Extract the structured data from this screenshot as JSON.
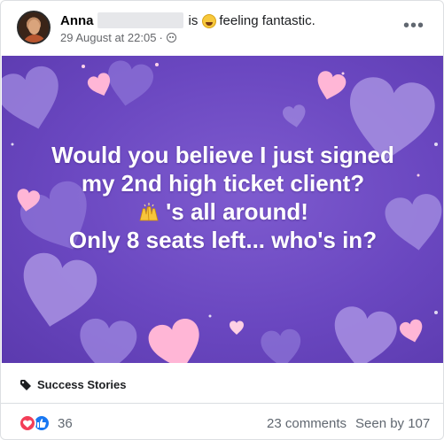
{
  "header": {
    "author": "Anna",
    "status_prefix": "is",
    "feeling_emoji": "laughing-face-icon",
    "feeling_text": "feeling fantastic.",
    "timestamp": "29 August at 22:05",
    "separator": "·",
    "audience_icon": "friends-icon",
    "more_label": "•••"
  },
  "post_image": {
    "text_lines": [
      "Would you believe I just signed",
      "my 2nd high ticket client?",
      "'s all around!",
      "Only 8 seats left... who's in?"
    ],
    "inline_emoji": "raising-hands-icon",
    "background_color": "#6a47c0",
    "heart_colors": [
      "#9d86dd",
      "#ffb3d4",
      "#7b5fcc"
    ]
  },
  "tag": {
    "icon": "tag-icon",
    "label": "Success Stories"
  },
  "footer": {
    "reaction_icons": [
      "love-reaction-icon",
      "like-reaction-icon"
    ],
    "reaction_count": "36",
    "comments": "23 comments",
    "seen_by": "Seen by 107"
  }
}
